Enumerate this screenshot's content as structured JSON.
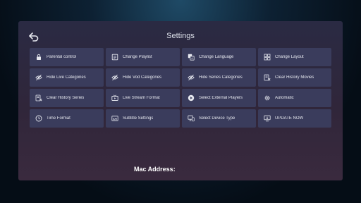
{
  "header": {
    "title": "Settings",
    "back_icon": "back-arrow-icon"
  },
  "grid": [
    {
      "label": "Parental control",
      "icon": "lock-icon"
    },
    {
      "label": "Change Playlist",
      "icon": "playlist-icon"
    },
    {
      "label": "Change Language",
      "icon": "language-icon"
    },
    {
      "label": "Change Layout",
      "icon": "layout-icon"
    },
    {
      "label": "Hide Live Categories",
      "icon": "eye-off-icon"
    },
    {
      "label": "Hide Vod Categories",
      "icon": "eye-off-icon"
    },
    {
      "label": "Hide Series Categories",
      "icon": "eye-off-icon"
    },
    {
      "label": "Clear History Movies",
      "icon": "clear-history-icon"
    },
    {
      "label": "Clear History Series",
      "icon": "clear-history-icon"
    },
    {
      "label": "Live Stream Format",
      "icon": "tv-icon"
    },
    {
      "label": "Select External Players",
      "icon": "play-icon"
    },
    {
      "label": "Automatic",
      "icon": "gear-icon"
    },
    {
      "label": "Time Format",
      "icon": "clock-icon"
    },
    {
      "label": "Subtitle Settings",
      "icon": "subtitle-icon"
    },
    {
      "label": "Select Device Type",
      "icon": "device-icon"
    },
    {
      "label": "UPDATE NOW",
      "icon": "update-icon"
    }
  ],
  "footer": {
    "mac_label": "Mac Address:"
  },
  "colors": {
    "button_bg": "#3a3c5c",
    "text": "#e6e8ef",
    "panel": "#2a2a43"
  }
}
